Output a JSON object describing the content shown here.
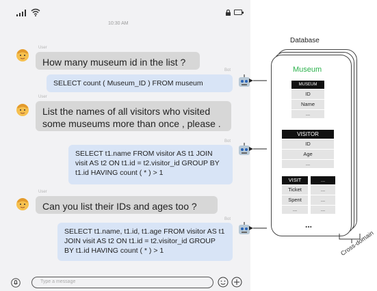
{
  "status": {
    "time": "10:30 AM"
  },
  "chat": [
    {
      "role_label": "User",
      "text": "How many museum id in the list ?"
    },
    {
      "role_label": "Bot",
      "text": "SELECT count ( Museum_ID ) FROM museum"
    },
    {
      "role_label": "User",
      "text": "List the names of all visitors who visited some museums more than once , please ."
    },
    {
      "role_label": "Bot",
      "text": "SELECT t1.name FROM visitor AS t1 JOIN visit AS t2 ON t1.id = t2.visitor_id GROUP BY t1.id HAVING count ( * ) > 1"
    },
    {
      "role_label": "User",
      "text": "Can you list their IDs and ages too ?"
    },
    {
      "role_label": "Bot",
      "text": "SELECT t1.name, t1.id, t1.age FROM visitor AS t1 JOIN visit AS t2 ON t1.id = t2.visitor_id GROUP BY t1.id HAVING count ( * ) > 1"
    }
  ],
  "composer": {
    "placeholder": "Type a message"
  },
  "database": {
    "title": "Database",
    "domain_label": "Museum",
    "museum_table": {
      "header": "MUSEUM",
      "columns": [
        "ID",
        "Name",
        "..."
      ]
    },
    "visitor_table": {
      "header": "VISITOR",
      "columns": [
        "ID",
        "Age",
        "..."
      ]
    },
    "visit_table": {
      "header": "VISIT",
      "columns": [
        "Ticket",
        "Spent",
        "..."
      ]
    },
    "extra_table": {
      "header": "...",
      "columns": [
        "...",
        "...",
        "..."
      ]
    },
    "more": "...",
    "footer": "Cross-domain"
  },
  "colors": {
    "user_bubble": "#d7d7d7",
    "bot_bubble": "#d8e4f6",
    "domain_green": "#2bb24c"
  }
}
